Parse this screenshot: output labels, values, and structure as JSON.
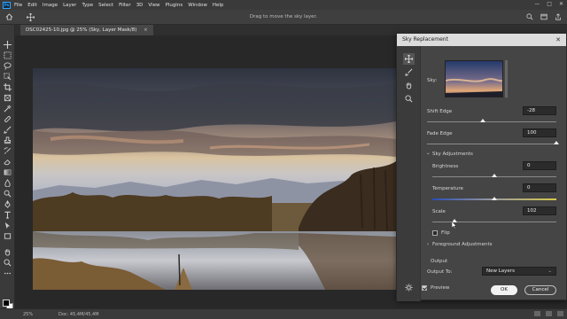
{
  "menubar": {
    "logo": "Ps",
    "items": [
      "File",
      "Edit",
      "Image",
      "Layer",
      "Type",
      "Select",
      "Filter",
      "3D",
      "View",
      "Plugins",
      "Window",
      "Help"
    ],
    "window_controls": [
      "—",
      "□",
      "✕"
    ]
  },
  "options_bar": {
    "hint": "Drag to move the sky layer."
  },
  "document": {
    "tab_title": "DSC02425-10.jpg @ 25% (Sky, Layer Mask/8)",
    "tab_close": "×",
    "zoom": "25%",
    "doc_info": "Doc: 45,4M/45,4M"
  },
  "dialog": {
    "title": "Sky Replacement",
    "close": "✕",
    "sky_label": "Sky:",
    "shift_edge": {
      "label": "Shift Edge",
      "value": "-28",
      "level": 0.43
    },
    "fade_edge": {
      "label": "Fade Edge",
      "value": "100",
      "level": 1.0
    },
    "sky_adjustments": {
      "label": "Sky Adjustments",
      "chevron": "⌄"
    },
    "brightness": {
      "label": "Brightness",
      "value": "0",
      "level": 0.5
    },
    "temperature": {
      "label": "Temperature",
      "value": "0",
      "level": 0.5
    },
    "scale": {
      "label": "Scale",
      "value": "102",
      "level": 0.18
    },
    "flip_label": "Flip",
    "flip_checked": false,
    "foreground_adjustments": {
      "label": "Foreground Adjustments",
      "chevron": "›"
    },
    "output_heading": "Output",
    "output_to_label": "Output To:",
    "output_to_value": "New Layers",
    "preview_label": "Preview",
    "preview_checked": true,
    "ok_label": "OK",
    "cancel_label": "Cancel"
  },
  "colors": {
    "accent": "#31a8ff",
    "panel": "#454545",
    "canvas": "#282828"
  }
}
